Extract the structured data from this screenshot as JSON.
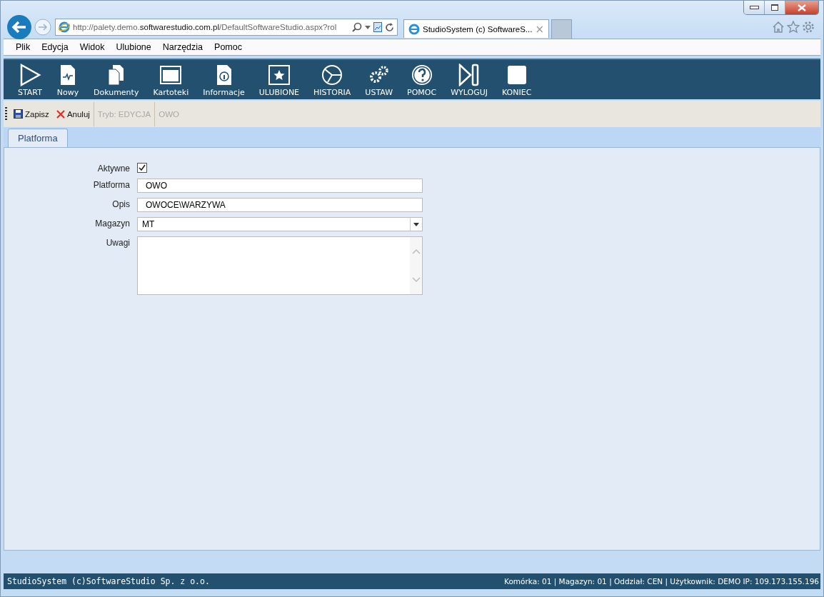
{
  "browser": {
    "address": "http://palety.demo.**softwarestudio.com.pl**/DefaultSoftwareStudio.aspx?rol",
    "tabs": [
      {
        "title": "StudioSystem (c) SoftwareS...",
        "close": "×",
        "selected": true
      }
    ]
  },
  "menu": [
    "Plik",
    "Edycja",
    "Widok",
    "Ulubione",
    "Narzędzia",
    "Pomoc"
  ],
  "toolbar": [
    {
      "kind": "play",
      "label": "START"
    },
    {
      "kind": "doc",
      "label": "Nowy"
    },
    {
      "kind": "docs",
      "label": "Dokumenty"
    },
    {
      "kind": "screen",
      "label": "Kartoteki"
    },
    {
      "kind": "info",
      "label": "Informacje"
    },
    {
      "kind": "star",
      "label": "ULUBIONE"
    },
    {
      "kind": "history",
      "label": "HISTORIA"
    },
    {
      "kind": "gears",
      "label": "USTAW"
    },
    {
      "kind": "help",
      "label": "POMOC"
    },
    {
      "kind": "logout",
      "label": "WYLOGUJ"
    },
    {
      "kind": "stop",
      "label": "KONIEC"
    }
  ],
  "actions": [
    {
      "kind": "save",
      "label": "Zapisz",
      "disabled": false
    },
    {
      "kind": "cancel",
      "label": "Anuluj",
      "disabled": false
    },
    {
      "kind": "text",
      "label": "Tryb: EDYCJA",
      "disabled": true
    },
    {
      "kind": "text",
      "label": "OWO",
      "disabled": true
    }
  ],
  "tabs": [
    {
      "label": "Platforma",
      "selected": true
    }
  ],
  "form": [
    {
      "kind": "checkbox",
      "label": "Aktywne",
      "checked": true
    },
    {
      "kind": "text",
      "label": "Platforma",
      "value": "OWO"
    },
    {
      "kind": "text",
      "label": "Opis",
      "value": "OWOCE\\WARZYWA"
    },
    {
      "kind": "select",
      "label": "Magazyn",
      "value": "MT"
    },
    {
      "kind": "textarea",
      "label": "Uwagi"
    }
  ],
  "status_bar": {
    "left": "StudioSystem (c)SoftwareStudio Sp. z o.o.",
    "right": "Komórka: 01 | Magazyn: 01 | Oddział: CEN | Użytkownik: DEMO IP: 109.173.155.196"
  }
}
